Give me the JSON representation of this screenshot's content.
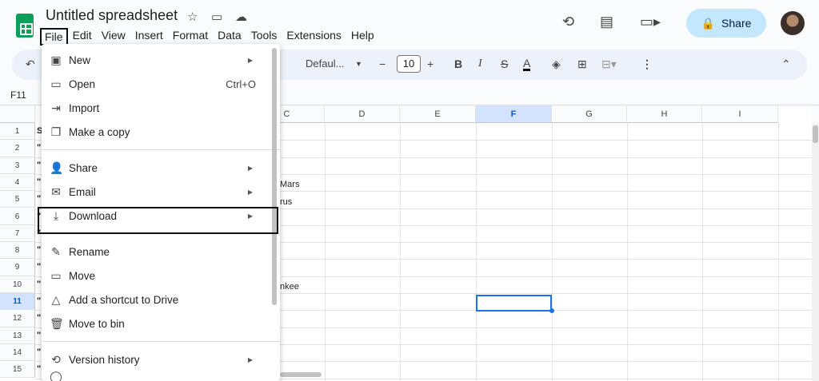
{
  "doc": {
    "title": "Untitled spreadsheet"
  },
  "menubar": [
    "File",
    "Edit",
    "View",
    "Insert",
    "Format",
    "Data",
    "Tools",
    "Extensions",
    "Help"
  ],
  "header": {
    "share_label": "Share"
  },
  "toolbar": {
    "font_name": "Defaul...",
    "font_size": "10",
    "bold": "B",
    "italic": "I",
    "strike": "S",
    "text_color": "A"
  },
  "namebox": "F11",
  "columns": [
    "C",
    "D",
    "E",
    "F",
    "G",
    "H",
    "I"
  ],
  "rows": [
    "1",
    "2",
    "3",
    "4",
    "5",
    "6",
    "7",
    "8",
    "9",
    "10",
    "11",
    "12",
    "13",
    "14",
    "15"
  ],
  "col_a_snippets": [
    "S",
    "\"",
    "\"",
    "\"",
    "\"",
    "\"",
    "\"",
    "\"",
    "\"",
    "\"",
    "\"",
    "\"",
    "\"",
    "\"",
    "\""
  ],
  "cells": {
    "c4": "Mars",
    "c5": "rus",
    "c10": "nkee"
  },
  "file_menu": {
    "new": "New",
    "open": "Open",
    "open_shortcut": "Ctrl+O",
    "import": "Import",
    "copy": "Make a copy",
    "share": "Share",
    "email": "Email",
    "download": "Download",
    "rename": "Rename",
    "move": "Move",
    "shortcut": "Add a shortcut to Drive",
    "bin": "Move to bin",
    "version": "Version history"
  }
}
